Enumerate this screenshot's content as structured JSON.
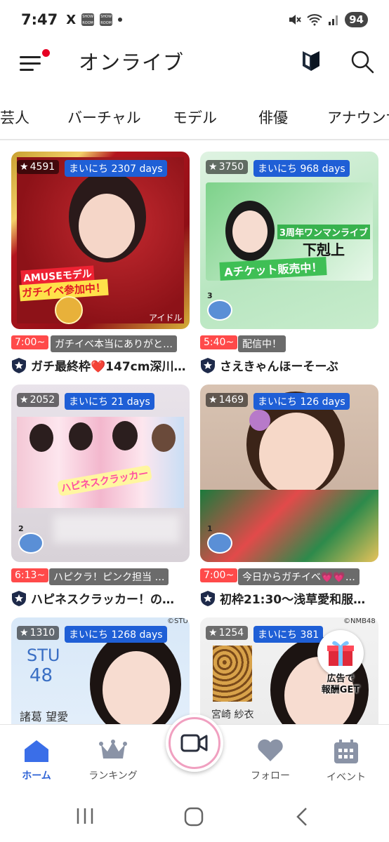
{
  "status_bar": {
    "time": "7:47",
    "x_icon": "X",
    "app_icon_text": "SHOW ROOM",
    "battery": "94"
  },
  "header": {
    "title": "オンライブ"
  },
  "tabs": [
    "芸人",
    "バーチャル",
    "モデル",
    "俳優",
    "アナウンサ"
  ],
  "cards": [
    {
      "stars": "4591",
      "days": "まいにち 2307 days",
      "time": "7:00~",
      "status": "ガチイベ本当にありがと…",
      "title": "ガチ最終枠❤️147cm深川…",
      "overlay_1": "AMUSEモデル",
      "overlay_2": "ガチイベ参加中！",
      "overlay_3": "アイドル"
    },
    {
      "stars": "3750",
      "days": "まいにち 968 days",
      "time": "5:40~",
      "status": "配信中！",
      "title": "さえきゃんほーそーぶ",
      "overlay_1": "3周年ワンマンライブ",
      "overlay_2": "下剋上",
      "overlay_3": "Aチケット販売中！",
      "rank": "3"
    },
    {
      "stars": "2052",
      "days": "まいにち 21 days",
      "time": "6:13~",
      "status": "ハピクラ！ピンク担当 …",
      "title": "ハピネスクラッカー！の…",
      "overlay_1": "ハピネスクラッカー",
      "rank": "2"
    },
    {
      "stars": "1469",
      "days": "まいにち 126 days",
      "time": "7:00~",
      "status": "今日からガチイベ💗💗…",
      "title": "初枠21:30〜浅草愛和服…",
      "rank": "1"
    },
    {
      "stars": "1310",
      "days": "まいにち 1268 days",
      "overlay_1": "STU",
      "overlay_2": "48",
      "overlay_3": "諸葛 望愛",
      "copyright": "©STU"
    },
    {
      "stars": "1254",
      "days": "まいにち 381",
      "overlay_3": "宮崎 紗衣",
      "copyright": "©NMB48"
    }
  ],
  "ad": {
    "line1": "広告で",
    "line2": "報酬GET"
  },
  "bottom_nav": {
    "home": "ホーム",
    "ranking": "ランキング",
    "follow": "フォロー",
    "event": "イベント"
  },
  "colors": {
    "accent": "#2e63d6",
    "days_pill": "#1f5fd6",
    "time_chip": "#ff4a4a",
    "notify_dot": "#e60023"
  }
}
